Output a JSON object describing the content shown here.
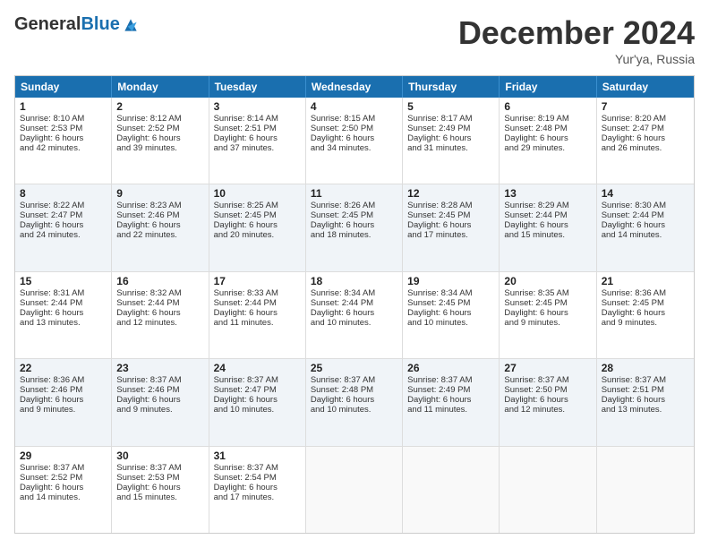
{
  "header": {
    "logo_general": "General",
    "logo_blue": "Blue",
    "month_title": "December 2024",
    "location": "Yur'ya, Russia"
  },
  "weekdays": [
    "Sunday",
    "Monday",
    "Tuesday",
    "Wednesday",
    "Thursday",
    "Friday",
    "Saturday"
  ],
  "rows": [
    [
      {
        "day": "1",
        "lines": [
          "Sunrise: 8:10 AM",
          "Sunset: 2:53 PM",
          "Daylight: 6 hours",
          "and 42 minutes."
        ]
      },
      {
        "day": "2",
        "lines": [
          "Sunrise: 8:12 AM",
          "Sunset: 2:52 PM",
          "Daylight: 6 hours",
          "and 39 minutes."
        ]
      },
      {
        "day": "3",
        "lines": [
          "Sunrise: 8:14 AM",
          "Sunset: 2:51 PM",
          "Daylight: 6 hours",
          "and 37 minutes."
        ]
      },
      {
        "day": "4",
        "lines": [
          "Sunrise: 8:15 AM",
          "Sunset: 2:50 PM",
          "Daylight: 6 hours",
          "and 34 minutes."
        ]
      },
      {
        "day": "5",
        "lines": [
          "Sunrise: 8:17 AM",
          "Sunset: 2:49 PM",
          "Daylight: 6 hours",
          "and 31 minutes."
        ]
      },
      {
        "day": "6",
        "lines": [
          "Sunrise: 8:19 AM",
          "Sunset: 2:48 PM",
          "Daylight: 6 hours",
          "and 29 minutes."
        ]
      },
      {
        "day": "7",
        "lines": [
          "Sunrise: 8:20 AM",
          "Sunset: 2:47 PM",
          "Daylight: 6 hours",
          "and 26 minutes."
        ]
      }
    ],
    [
      {
        "day": "8",
        "lines": [
          "Sunrise: 8:22 AM",
          "Sunset: 2:47 PM",
          "Daylight: 6 hours",
          "and 24 minutes."
        ]
      },
      {
        "day": "9",
        "lines": [
          "Sunrise: 8:23 AM",
          "Sunset: 2:46 PM",
          "Daylight: 6 hours",
          "and 22 minutes."
        ]
      },
      {
        "day": "10",
        "lines": [
          "Sunrise: 8:25 AM",
          "Sunset: 2:45 PM",
          "Daylight: 6 hours",
          "and 20 minutes."
        ]
      },
      {
        "day": "11",
        "lines": [
          "Sunrise: 8:26 AM",
          "Sunset: 2:45 PM",
          "Daylight: 6 hours",
          "and 18 minutes."
        ]
      },
      {
        "day": "12",
        "lines": [
          "Sunrise: 8:28 AM",
          "Sunset: 2:45 PM",
          "Daylight: 6 hours",
          "and 17 minutes."
        ]
      },
      {
        "day": "13",
        "lines": [
          "Sunrise: 8:29 AM",
          "Sunset: 2:44 PM",
          "Daylight: 6 hours",
          "and 15 minutes."
        ]
      },
      {
        "day": "14",
        "lines": [
          "Sunrise: 8:30 AM",
          "Sunset: 2:44 PM",
          "Daylight: 6 hours",
          "and 14 minutes."
        ]
      }
    ],
    [
      {
        "day": "15",
        "lines": [
          "Sunrise: 8:31 AM",
          "Sunset: 2:44 PM",
          "Daylight: 6 hours",
          "and 13 minutes."
        ]
      },
      {
        "day": "16",
        "lines": [
          "Sunrise: 8:32 AM",
          "Sunset: 2:44 PM",
          "Daylight: 6 hours",
          "and 12 minutes."
        ]
      },
      {
        "day": "17",
        "lines": [
          "Sunrise: 8:33 AM",
          "Sunset: 2:44 PM",
          "Daylight: 6 hours",
          "and 11 minutes."
        ]
      },
      {
        "day": "18",
        "lines": [
          "Sunrise: 8:34 AM",
          "Sunset: 2:44 PM",
          "Daylight: 6 hours",
          "and 10 minutes."
        ]
      },
      {
        "day": "19",
        "lines": [
          "Sunrise: 8:34 AM",
          "Sunset: 2:45 PM",
          "Daylight: 6 hours",
          "and 10 minutes."
        ]
      },
      {
        "day": "20",
        "lines": [
          "Sunrise: 8:35 AM",
          "Sunset: 2:45 PM",
          "Daylight: 6 hours",
          "and 9 minutes."
        ]
      },
      {
        "day": "21",
        "lines": [
          "Sunrise: 8:36 AM",
          "Sunset: 2:45 PM",
          "Daylight: 6 hours",
          "and 9 minutes."
        ]
      }
    ],
    [
      {
        "day": "22",
        "lines": [
          "Sunrise: 8:36 AM",
          "Sunset: 2:46 PM",
          "Daylight: 6 hours",
          "and 9 minutes."
        ]
      },
      {
        "day": "23",
        "lines": [
          "Sunrise: 8:37 AM",
          "Sunset: 2:46 PM",
          "Daylight: 6 hours",
          "and 9 minutes."
        ]
      },
      {
        "day": "24",
        "lines": [
          "Sunrise: 8:37 AM",
          "Sunset: 2:47 PM",
          "Daylight: 6 hours",
          "and 10 minutes."
        ]
      },
      {
        "day": "25",
        "lines": [
          "Sunrise: 8:37 AM",
          "Sunset: 2:48 PM",
          "Daylight: 6 hours",
          "and 10 minutes."
        ]
      },
      {
        "day": "26",
        "lines": [
          "Sunrise: 8:37 AM",
          "Sunset: 2:49 PM",
          "Daylight: 6 hours",
          "and 11 minutes."
        ]
      },
      {
        "day": "27",
        "lines": [
          "Sunrise: 8:37 AM",
          "Sunset: 2:50 PM",
          "Daylight: 6 hours",
          "and 12 minutes."
        ]
      },
      {
        "day": "28",
        "lines": [
          "Sunrise: 8:37 AM",
          "Sunset: 2:51 PM",
          "Daylight: 6 hours",
          "and 13 minutes."
        ]
      }
    ],
    [
      {
        "day": "29",
        "lines": [
          "Sunrise: 8:37 AM",
          "Sunset: 2:52 PM",
          "Daylight: 6 hours",
          "and 14 minutes."
        ]
      },
      {
        "day": "30",
        "lines": [
          "Sunrise: 8:37 AM",
          "Sunset: 2:53 PM",
          "Daylight: 6 hours",
          "and 15 minutes."
        ]
      },
      {
        "day": "31",
        "lines": [
          "Sunrise: 8:37 AM",
          "Sunset: 2:54 PM",
          "Daylight: 6 hours",
          "and 17 minutes."
        ]
      },
      null,
      null,
      null,
      null
    ]
  ]
}
